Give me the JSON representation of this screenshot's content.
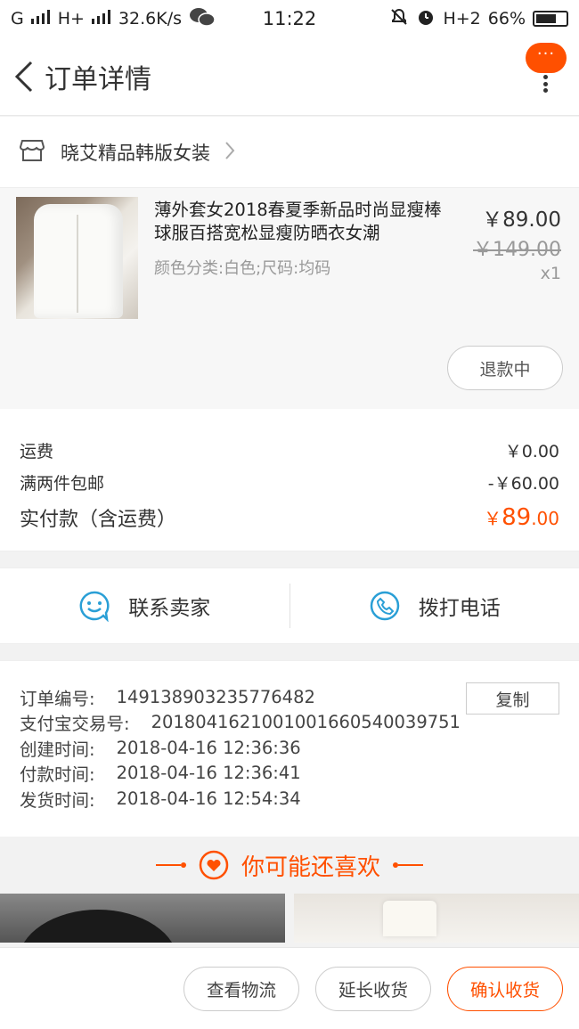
{
  "status_bar": {
    "carrier_left": "G",
    "carrier_right": "H+",
    "speed": "32.6K/s",
    "time": "11:22",
    "network": "H+2",
    "battery": "66%"
  },
  "nav": {
    "title": "订单详情",
    "more_label": "···"
  },
  "shop": {
    "name": "晓艾精品韩版女装"
  },
  "product": {
    "title": "薄外套女2018春夏季新品时尚显瘦棒球服百搭宽松显瘦防晒衣女潮",
    "sku": "颜色分类:白色;尺码:均码",
    "price_now": "￥89.00",
    "price_old": "￥149.00",
    "qty": "x1",
    "refund_label": "退款中"
  },
  "fees": {
    "shipping_label": "运费",
    "shipping_value": "￥0.00",
    "discount_label": "满两件包邮",
    "discount_value": "-￥60.00",
    "total_label": "实付款（含运费）",
    "total_symbol": "￥",
    "total_int": "89",
    "total_dec": ".00"
  },
  "contact": {
    "seller_label": "联系卖家",
    "phone_label": "拨打电话"
  },
  "info": {
    "copy_label": "复制",
    "rows": [
      {
        "label": "订单编号:",
        "value": "149138903235776482"
      },
      {
        "label": "支付宝交易号:",
        "value": "2018041621001001660540039751"
      },
      {
        "label": "创建时间:",
        "value": "2018-04-16 12:36:36"
      },
      {
        "label": "付款时间:",
        "value": "2018-04-16 12:36:41"
      },
      {
        "label": "发货时间:",
        "value": "2018-04-16 12:54:34"
      }
    ]
  },
  "recommend": {
    "title": "你可能还喜欢"
  },
  "bottom_bar": {
    "logistics_label": "查看物流",
    "extend_label": "延长收货",
    "confirm_label": "确认收货"
  },
  "colors": {
    "accent": "#ff5000",
    "contact_icon": "#2a9fd6"
  }
}
